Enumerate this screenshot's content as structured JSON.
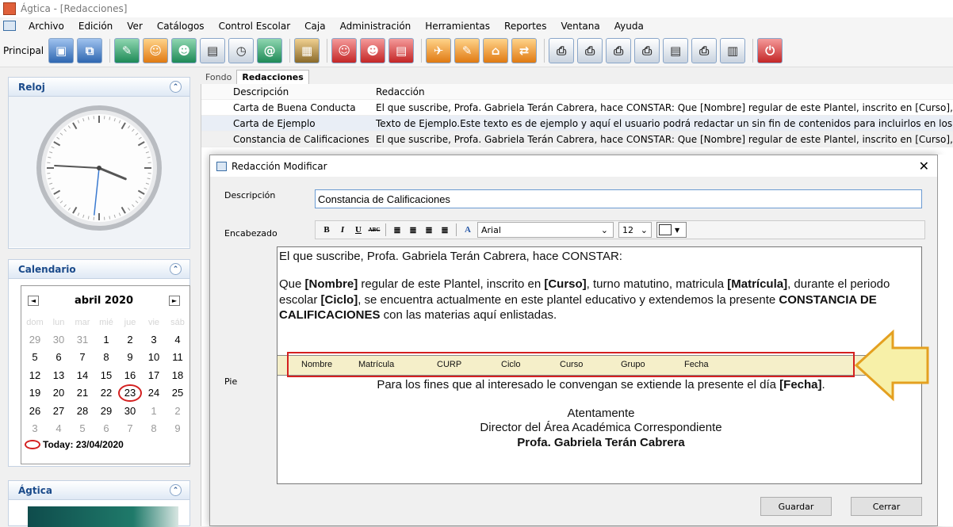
{
  "window": {
    "title": "Ágtica - [Redacciones]"
  },
  "menu": [
    "Archivo",
    "Edición",
    "Ver",
    "Catálogos",
    "Control Escolar",
    "Caja",
    "Administración",
    "Herramientas",
    "Reportes",
    "Ventana",
    "Ayuda"
  ],
  "toolbar": {
    "label": "Principal"
  },
  "panels": {
    "clock": {
      "title": "Reloj",
      "time_hour": 3,
      "time_minute": 45,
      "time_second": 31
    },
    "calendar": {
      "title": "Calendario",
      "month": "abril 2020",
      "prev": "◄",
      "next": "►",
      "weekdays": [
        "dom",
        "lun",
        "mar",
        "mié",
        "jue",
        "vie",
        "sáb"
      ],
      "weeks": [
        [
          "29",
          "30",
          "31",
          "1",
          "2",
          "3",
          "4"
        ],
        [
          "5",
          "6",
          "7",
          "8",
          "9",
          "10",
          "11"
        ],
        [
          "12",
          "13",
          "14",
          "15",
          "16",
          "17",
          "18"
        ],
        [
          "19",
          "20",
          "21",
          "22",
          "23",
          "24",
          "25"
        ],
        [
          "26",
          "27",
          "28",
          "29",
          "30",
          "1",
          "2"
        ],
        [
          "3",
          "4",
          "5",
          "6",
          "7",
          "8",
          "9"
        ]
      ],
      "today": "Today: 23/04/2020"
    },
    "agtica": {
      "title": "Ágtica"
    }
  },
  "tabs": [
    "Fondo",
    "Redacciones"
  ],
  "list": {
    "headers": [
      "Descripción",
      "Redacción"
    ],
    "rows": [
      [
        "Carta de Buena Conducta",
        "El que suscribe, Profa. Gabriela Terán Cabrera, hace CONSTAR: Que [Nombre] regular de este Plantel, inscrito en [Curso], t"
      ],
      [
        "Carta de Ejemplo",
        "Texto de Ejemplo.Este texto es de ejemplo y aquí el usuario podrá redactar un sin fin de contenidos para incluirlos en los rep"
      ],
      [
        "Constancia de Calificaciones",
        "El que suscribe, Profa. Gabriela Terán Cabrera, hace CONSTAR: Que [Nombre] regular de este Plantel, inscrito en [Curso], t"
      ]
    ]
  },
  "dialog": {
    "title": "Redacción Modificar",
    "close": "✕",
    "labels": {
      "descripcion": "Descripción",
      "encabezado": "Encabezado",
      "pie": "Pie"
    },
    "descripcion_value": "Constancia de Calificaciones",
    "format": {
      "bold": "B",
      "italic": "I",
      "underline": "U",
      "strike": "ABC",
      "font": "Arial",
      "size": "12"
    },
    "body": {
      "l1": "El que suscribe, Profa. Gabriela Terán Cabrera, hace CONSTAR:",
      "l2a": "Que ",
      "l2b": "[Nombre]",
      "l2c": " regular de este Plantel, inscrito en ",
      "l2d": "[Curso]",
      "l2e": ", turno matutino, matricula ",
      "l2f": "[Matrícula]",
      "l2g": ", durante el periodo",
      "l3a": "escolar ",
      "l3b": "[Ciclo]",
      "l3c": ", se encuentra actualmente en este plantel educativo y extendemos la presente ",
      "l3d": "CONSTANCIA DE",
      "l4a": "CALIFICACIONES",
      "l4b": " con las materias aquí enlistadas."
    },
    "fields": [
      "Nombre",
      "Matrícula",
      "CURP",
      "Ciclo",
      "Curso",
      "Grupo",
      "Fecha"
    ],
    "footer": {
      "l1a": "Para los fines que al interesado le convengan se extiende la presente el día ",
      "l1b": "[Fecha]",
      "l1c": ".",
      "l2": "Atentamente",
      "l3": "Director del Área Académica Correspondiente",
      "l4": "Profa. Gabriela Terán Cabrera"
    },
    "buttons": {
      "save": "Guardar",
      "close": "Cerrar"
    }
  },
  "colors": {
    "accent": "#1a4a8a",
    "highlight_red": "#d42020",
    "arrow_yellow": "#f7f0a8"
  }
}
